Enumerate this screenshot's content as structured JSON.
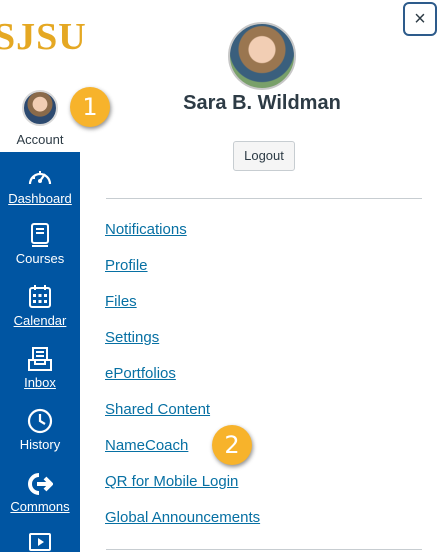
{
  "logo": {
    "text": "SJSU"
  },
  "account": {
    "label": "Account"
  },
  "callouts": [
    {
      "number": "1"
    },
    {
      "number": "2"
    }
  ],
  "nav": [
    {
      "label": "Dashboard",
      "icon": "dashboard-icon"
    },
    {
      "label": "Courses",
      "icon": "courses-icon"
    },
    {
      "label": "Calendar",
      "icon": "calendar-icon"
    },
    {
      "label": "Inbox",
      "icon": "inbox-icon"
    },
    {
      "label": "History",
      "icon": "history-icon"
    },
    {
      "label": "Commons",
      "icon": "commons-icon"
    },
    {
      "label": "",
      "icon": "media-icon"
    }
  ],
  "tray": {
    "close_label": "×",
    "user_name": "Sara B. Wildman",
    "logout_label": "Logout",
    "links": [
      "Notifications",
      "Profile",
      "Files",
      "Settings",
      "ePortfolios",
      "Shared Content",
      "NameCoach",
      "QR for Mobile Login",
      "Global Announcements"
    ]
  },
  "colors": {
    "sidebar": "#0055a2",
    "logo": "#e5a823",
    "badge": "#f7b32b",
    "link": "#0770a3"
  }
}
